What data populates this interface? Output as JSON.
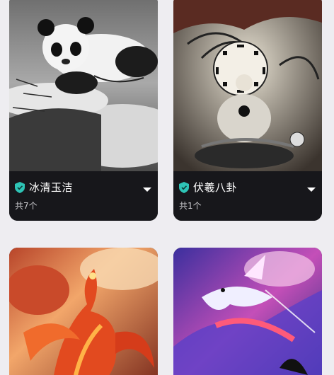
{
  "cards": [
    {
      "title": "冰清玉洁",
      "count": "共7个",
      "accent": "#2ec4b6",
      "image": "panda-ink-painting"
    },
    {
      "title": "伏羲八卦",
      "count": "共1个",
      "accent": "#2ec4b6",
      "image": "fuxi-bagua-painting"
    },
    {
      "image": "phoenix-fire-painting"
    },
    {
      "image": "dragon-neon-painting"
    }
  ]
}
